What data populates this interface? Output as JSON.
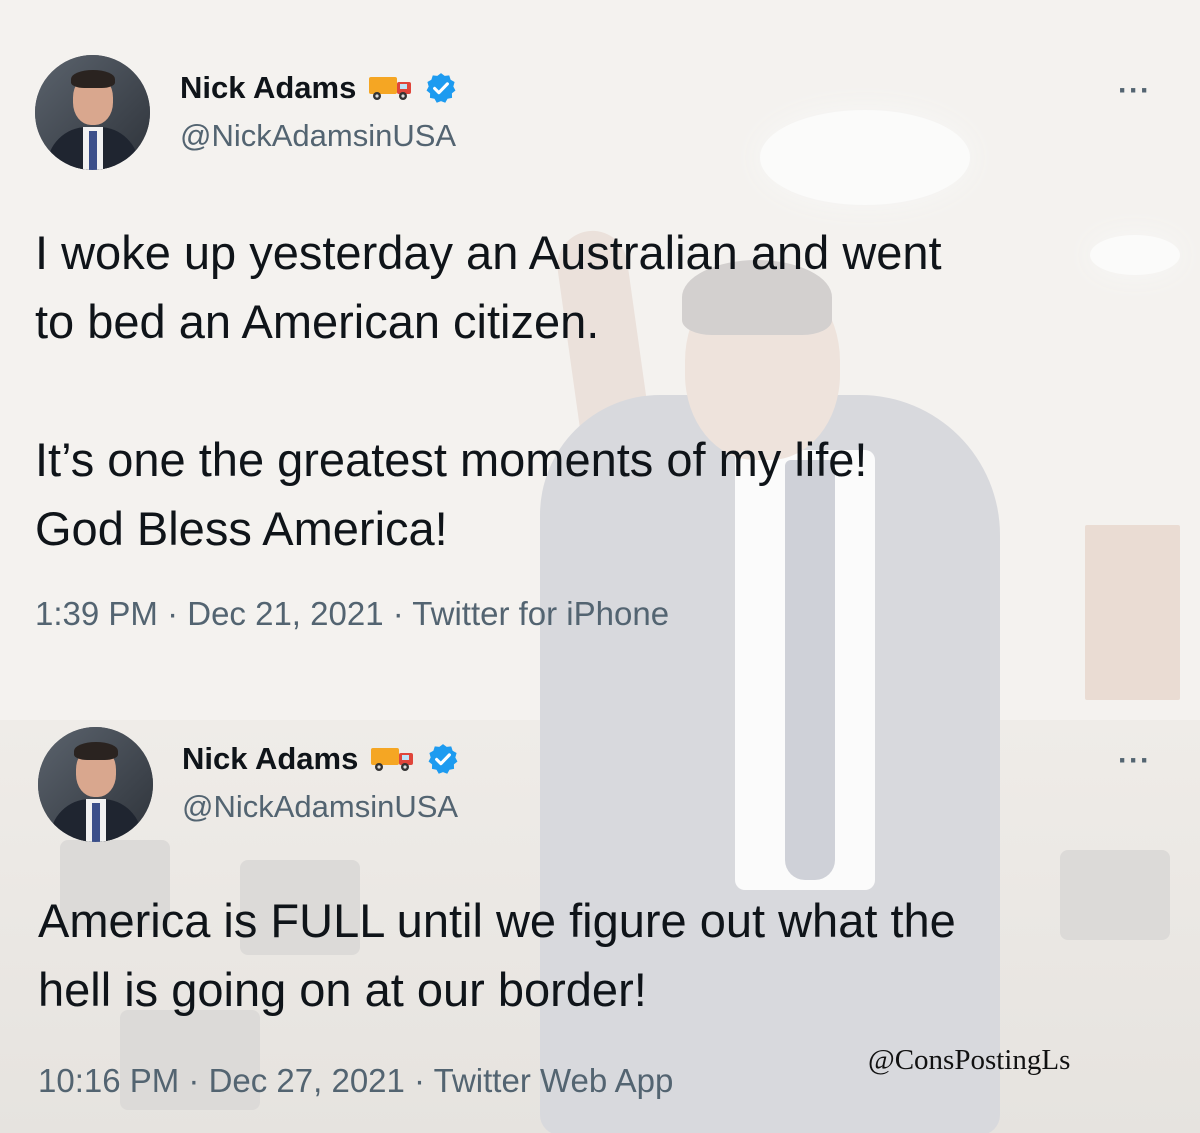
{
  "tweets": [
    {
      "display_name": "Nick Adams",
      "handle": "@NickAdamsinUSA",
      "text": "I woke up yesterday an Australian and went\nto bed an American citizen.\n\nIt’s one the greatest moments of my life!\nGod Bless America!",
      "time": "1:39 PM",
      "date": "Dec 21, 2021",
      "source": "Twitter for iPhone",
      "separator": " · "
    },
    {
      "display_name": "Nick Adams",
      "handle": "@NickAdamsinUSA",
      "text": "America is FULL until we figure out what the\nhell is going on at our border!",
      "time": "10:16 PM",
      "date": "Dec 27, 2021",
      "source": "Twitter Web App",
      "separator": " · "
    }
  ],
  "icons": {
    "name_emoji": "delivery-truck-icon",
    "verified": "verified-badge-icon",
    "more": "more-options-icon"
  },
  "colors": {
    "verified_blue": "#1d9bf0",
    "secondary_text": "#536471",
    "primary_text": "#0f1419"
  },
  "watermark": "@ConsPostingLs"
}
